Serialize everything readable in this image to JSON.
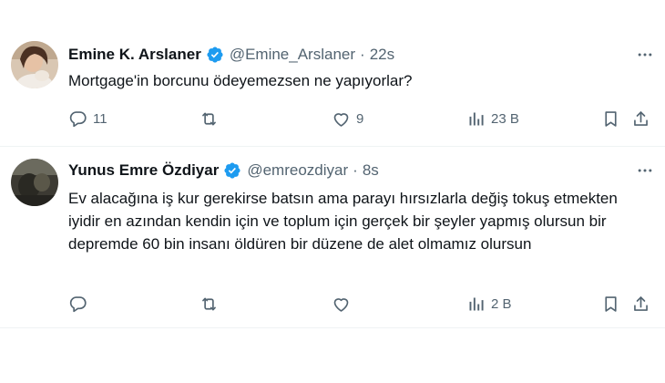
{
  "tweets": [
    {
      "author_name": "Emine K. Arslaner",
      "handle": "@Emine_Arslaner",
      "separator": "·",
      "time": "22s",
      "text": "Mortgage'in borcunu ödeyemezsen ne yapıyorlar?",
      "replies": "11",
      "reposts": "",
      "likes": "9",
      "views": "23 B"
    },
    {
      "author_name": "Yunus Emre Özdiyar",
      "handle": "@emreozdiyar",
      "separator": "·",
      "time": "8s",
      "text": "Ev alacağına iş kur gerekirse batsın ama parayı hırsızlarla değiş tokuş etmekten iyidir en azından kendin için ve toplum için gerçek bir şeyler yapmış olursun bir depremde 60 bin insanı öldüren bir düzene de alet olmamız olursun",
      "replies": "",
      "reposts": "",
      "likes": "",
      "views": "2 B"
    }
  ],
  "icons": {
    "verified": "verified-badge-icon",
    "more": "more-dots-icon",
    "reply": "reply-bubble-icon",
    "repost": "repost-icon",
    "like": "heart-icon",
    "views": "analytics-bars-icon",
    "bookmark": "bookmark-icon",
    "share": "share-upload-icon"
  },
  "colors": {
    "verified_blue": "#1d9bf0",
    "secondary_text": "#536471",
    "primary_text": "#0f1419",
    "divider": "#eff3f4"
  }
}
